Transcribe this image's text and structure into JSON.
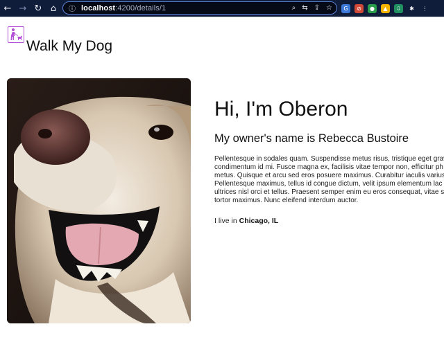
{
  "browser": {
    "url_host": "localhost",
    "url_rest": ":4200/details/1",
    "back_icon": "arrow-left",
    "forward_icon": "arrow-right",
    "reload_icon": "reload",
    "home_icon": "home",
    "info_icon": "info",
    "back_glyph": "←",
    "forward_glyph": "→",
    "reload_glyph": "↻",
    "home_glyph": "⌂",
    "info_glyph": "ⓘ",
    "omnibox_glyphs": [
      "⌕",
      "⇆",
      "⇪",
      "☆"
    ],
    "extensions": [
      {
        "name": "google-translate",
        "label": "G",
        "color": "#3c78d8"
      },
      {
        "name": "blocker",
        "label": "⊘",
        "color": "#d14836"
      },
      {
        "name": "extension-green",
        "label": "●",
        "color": "#2a9d4a"
      },
      {
        "name": "drive",
        "label": "▲",
        "color": "#f4b400"
      },
      {
        "name": "download",
        "label": "⇩",
        "color": "#1f8f5f"
      },
      {
        "name": "puzzle",
        "label": "✱",
        "color": "#0f1c3a"
      },
      {
        "name": "menu",
        "label": "⋮",
        "color": "#0f1c3a"
      }
    ]
  },
  "header": {
    "brand": "Walk My Dog",
    "logo_icon": "dog-walker-icon",
    "logo_color": "#b24fd6"
  },
  "details": {
    "greeting": "Hi, I'm Oberon",
    "owner_line": "My owner's name is Rebecca Bustoire",
    "description_lines": [
      "Pellentesque in sodales quam. Suspendisse metus risus, tristique eget grav",
      "condimentum id mi. Fusce magna ex, facilisis vitae tempor non, efficitur ph",
      "metus. Quisque et arcu sed eros posuere maximus. Curabitur iaculis varius",
      "Pellentesque maximus, tellus id congue dictum, velit ipsum elementum lac",
      "ultrices nisl orci et tellus. Praesent semper enim eu eros consequat, vitae s",
      "tortor maximus. Nunc eleifend interdum auctor."
    ],
    "location_prefix": "I live in ",
    "location_city": "Chicago, IL"
  }
}
